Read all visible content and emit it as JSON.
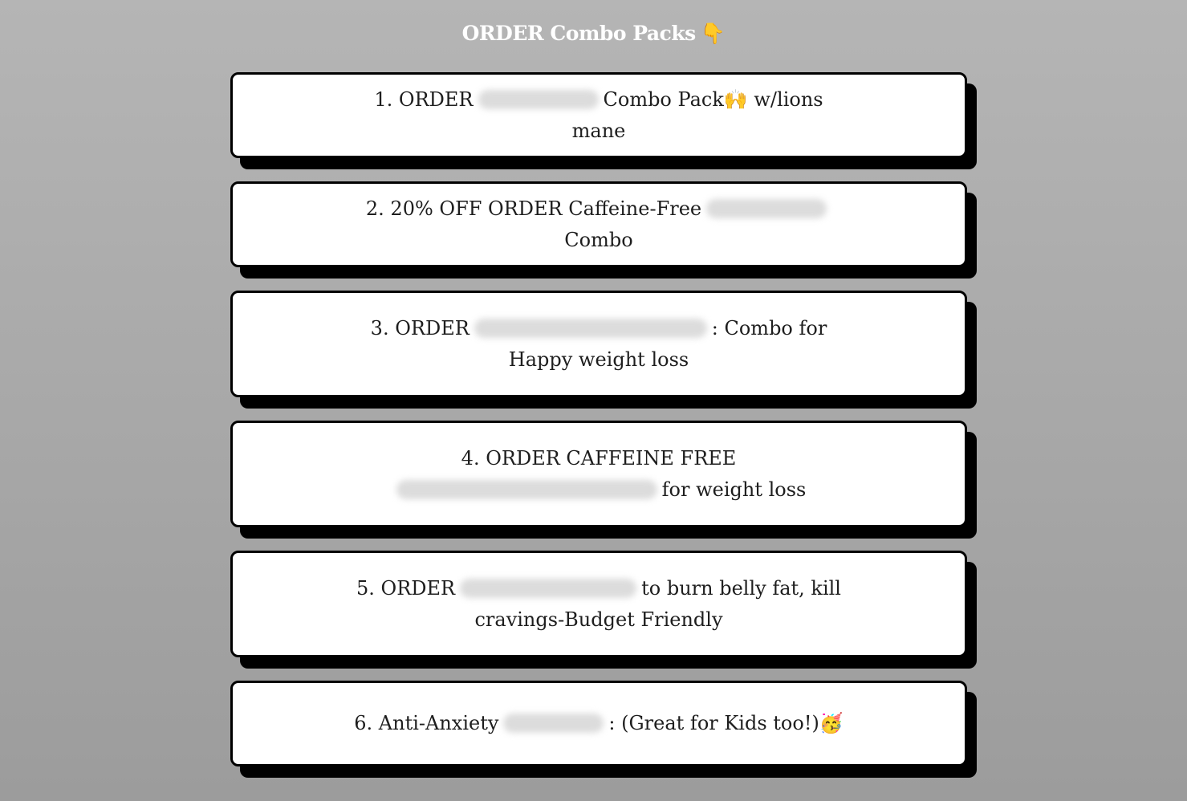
{
  "header": {
    "title": "ORDER Combo Packs",
    "title_emoji": "👇"
  },
  "links": [
    {
      "before": "1. ORDER",
      "redacted": true,
      "after": "Combo Pack🙌 w/lions mane"
    },
    {
      "before": "2. 20% OFF ORDER Caffeine-Free",
      "redacted": true,
      "after": "Combo"
    },
    {
      "before": "3. ORDER",
      "redacted": true,
      "after": ": Combo for Happy weight loss"
    },
    {
      "before": "4. ORDER CAFFEINE FREE",
      "redacted": true,
      "after": "for weight loss"
    },
    {
      "before": "5. ORDER",
      "redacted": true,
      "after": "to burn belly fat, kill cravings-Budget Friendly"
    },
    {
      "before": "6. Anti-Anxiety",
      "redacted": true,
      "after": ": (Great for Kids too!)🥳"
    }
  ]
}
